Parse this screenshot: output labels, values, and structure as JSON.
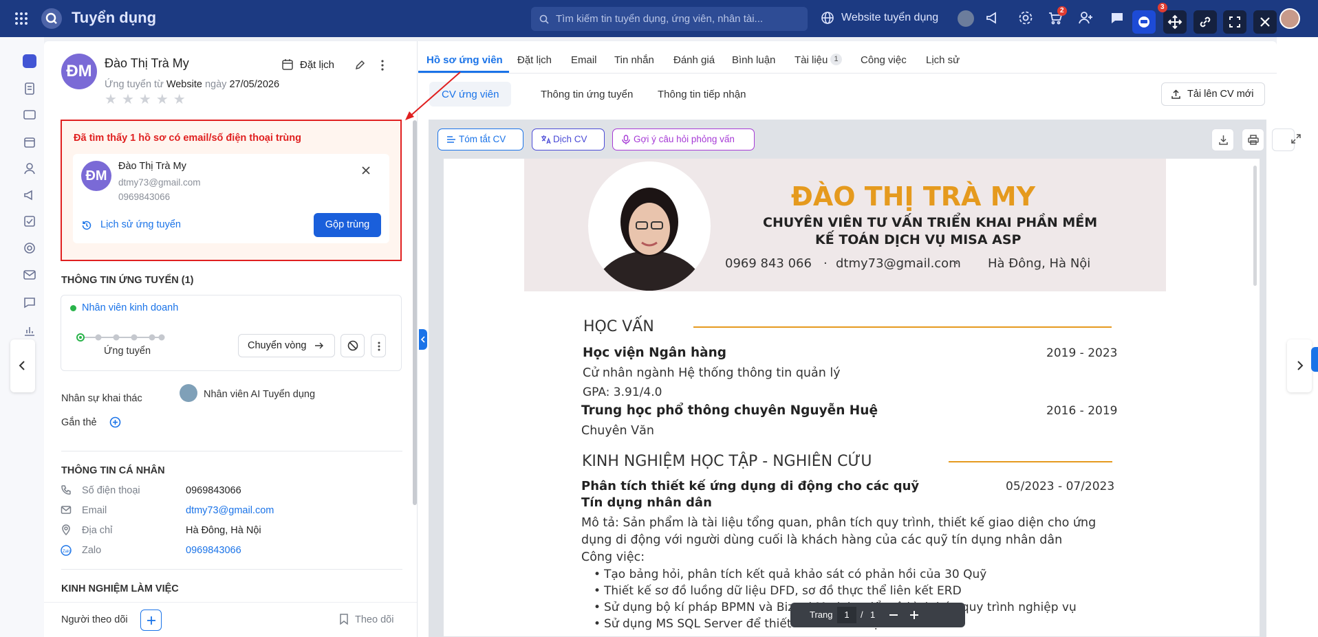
{
  "topbar": {
    "app_title": "Tuyển dụng",
    "search_placeholder": "Tìm kiếm tin tuyển dụng, ứng viên, nhân tài...",
    "website_label": "Website tuyển dụng",
    "cart_badge": "2",
    "right_badge": "3"
  },
  "candidate": {
    "initials": "ĐM",
    "name": "Đào Thị Trà My",
    "applied_prefix": "Ứng tuyển từ",
    "applied_source": "Website",
    "applied_day_prefix": "ngày",
    "applied_date": "27/05/2026",
    "schedule_label": "Đặt lịch"
  },
  "duplicate": {
    "alert": "Đã tìm thấy 1 hồ sơ có email/số điện thoại trùng",
    "initials": "ĐM",
    "name": "Đào Thị Trà My",
    "email": "dtmy73@gmail.com",
    "phone": "0969843066",
    "history_label": "Lịch sử ứng tuyển",
    "merge_label": "Gộp trùng"
  },
  "application": {
    "section_title": "THÔNG TIN ỨNG TUYỂN (1)",
    "position": "Nhân viên kinh doanh",
    "stage": "Ứng tuyển",
    "move_label": "Chuyển vòng",
    "recruiter_label": "Nhân sự khai thác",
    "recruiter_name": "Nhân viên AI Tuyển dụng",
    "tag_label": "Gắn thẻ"
  },
  "personal": {
    "section_title": "THÔNG TIN CÁ NHÂN",
    "phone_label": "Số điện thoại",
    "phone": "0969843066",
    "email_label": "Email",
    "email": "dtmy73@gmail.com",
    "address_label": "Địa chỉ",
    "address": "Hà Đông, Hà Nội",
    "zalo_label": "Zalo",
    "zalo": "0969843066"
  },
  "work_section_title": "KINH NGHIỆM LÀM VIỆC",
  "footer": {
    "followers_label": "Người theo dõi",
    "follow_label": "Theo dõi"
  },
  "tabs": [
    "Hồ sơ ứng viên",
    "Đặt lịch",
    "Email",
    "Tin nhắn",
    "Đánh giá",
    "Bình luận",
    "Tài liệu",
    "Công việc",
    "Lịch sử"
  ],
  "doc_count": "1",
  "subtabs": [
    "CV ứng viên",
    "Thông tin ứng tuyển",
    "Thông tin tiếp nhận"
  ],
  "upload_label": "Tải lên CV mới",
  "cv_tools": {
    "summary": "Tóm tắt CV",
    "translate": "Dịch CV",
    "suggest": "Gợi ý câu hỏi phỏng vấn"
  },
  "pager": {
    "label": "Trang",
    "page": "1",
    "sep": "/",
    "total": "1"
  },
  "cv": {
    "name": "ĐÀO THỊ TRÀ MY",
    "title1": "CHUYÊN VIÊN TƯ VẤN TRIỂN KHAI PHẦN MỀM",
    "title2": "KẾ TOÁN DỊCH VỤ MISA ASP",
    "phone": "0969 843 066",
    "dot": "·",
    "email": "dtmy73@gmail.com",
    "location": "Hà Đông, Hà Nội",
    "edu_heading": "HỌC VẤN",
    "edu1_school": "Học viện Ngân hàng",
    "edu1_years": "2019 - 2023",
    "edu1_major": "Cử nhân ngành Hệ thống thông tin quản lý",
    "edu1_gpa": "GPA: 3.91/4.0",
    "edu2_school": "Trung học phổ thông chuyên Nguyễn Huệ",
    "edu2_years": "2016 - 2019",
    "edu2_major": "Chuyên Văn",
    "exp_heading": "KINH NGHIỆM HỌC TẬP - NGHIÊN CỨU",
    "exp1_title1": "Phân tích thiết kế ứng dụng di động cho các quỹ",
    "exp1_title2": "Tín dụng nhân dân",
    "exp1_period": "05/2023 - 07/2023",
    "exp1_desc1": "Mô tả: Sản phẩm là tài liệu tổng quan, phân tích quy trình, thiết kế giao diện cho ứng",
    "exp1_desc2": "dụng di động với người dùng cuối là khách hàng của các quỹ tín dụng nhân dân",
    "exp1_work": "Công việc:",
    "bullets": [
      "Tạo bảng hỏi, phân tích kết quả khảo sát có phản hồi của 30 Quỹ",
      "Thiết kế sơ đồ luồng dữ liệu DFD, sơ đồ thực thể liên kết ERD",
      "Sử dụng bộ kí pháp BPMN và Bizagi Modeler để mô hình hóa quy trình nghiệp vụ",
      "Sử dụng MS SQL Server để thiết kế cơ sở dữ liệu"
    ]
  },
  "colors": {
    "primary": "#1a73e8",
    "alert_red": "#e02020",
    "accent_orange": "#e59a1e",
    "topbar": "#1c3a82"
  }
}
